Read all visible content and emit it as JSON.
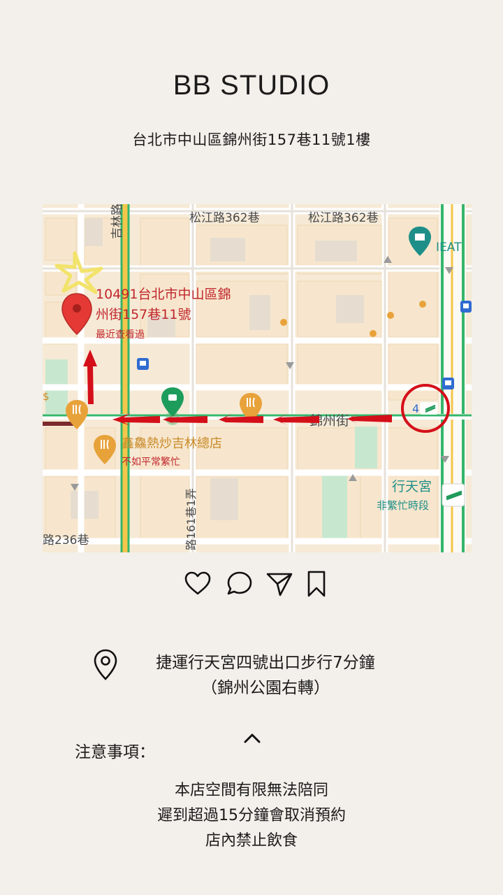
{
  "header": {
    "title": "BB STUDIO",
    "address": "台北市中山區錦州街157巷11號1樓"
  },
  "map": {
    "road_labels": [
      "松江路362巷",
      "松江路362巷",
      "吉林路",
      "錦州街",
      "路236巷",
      "路161巷1弄"
    ],
    "place_labels": {
      "destination_line1": "10491台北市中山區錦",
      "destination_line2": "州街157巷11號",
      "destination_sub": "最近查看過",
      "restaurant_name": "鑫鱻熱炒吉林總店",
      "restaurant_sub": "不如平常繁忙",
      "station_name": "行天宮",
      "station_sub": "非繁忙時段",
      "poi_right": "IEAT",
      "exit_number": "4",
      "left_fragment": "$"
    },
    "colors": {
      "arrow": "#d40f1a",
      "pin": "#e53935",
      "poi_orange": "#e8a23a",
      "road_green": "#35b56a",
      "station_teal": "#1e8f88"
    }
  },
  "actions": {
    "icons": [
      "heart-icon",
      "comment-icon",
      "send-icon",
      "bookmark-icon"
    ]
  },
  "directions": {
    "line1": "捷運行天宮四號出口步行7分鐘",
    "line2": "（錦州公園右轉）"
  },
  "notice": {
    "heading": "注意事項：",
    "items": [
      "本店空間有限無法陪同",
      "遲到超過15分鐘會取消預約",
      "店內禁止飲食"
    ]
  }
}
